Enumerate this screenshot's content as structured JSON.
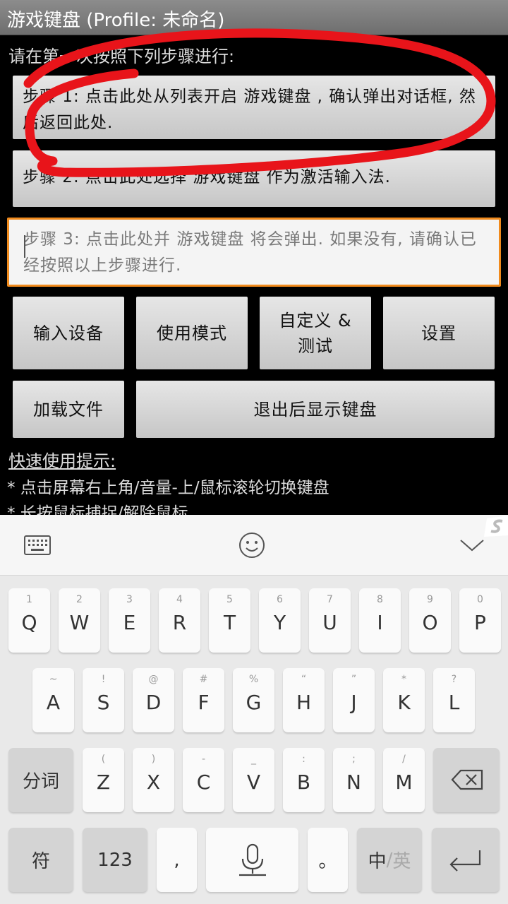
{
  "title": "游戏键盘 (Profile: 未命名)",
  "instruction": "请在第一次按照下列步骤进行:",
  "steps": [
    "步骤 1: 点击此处从列表开启 游戏键盘 , 确认弹出对话框, 然后返回此处.",
    "步骤 2: 点击此处选择 游戏键盘 作为激活输入法.",
    "步骤 3: 点击此处并 游戏键盘 将会弹出. 如果没有, 请确认已经按照以上步骤进行."
  ],
  "buttons": {
    "input_device": "输入设备",
    "use_mode": "使用模式",
    "customize_test_line1": "自定义 &",
    "customize_test_line2": "测试",
    "settings": "设置",
    "load_file": "加载文件",
    "show_keyboard_on_exit": "退出后显示键盘"
  },
  "tips": {
    "heading": "快速使用提示:",
    "items": [
      "* 点击屏幕右上角/音量-上/鼠标滚轮切换键盘",
      "* 长按鼠标捕捉/解除鼠标"
    ]
  },
  "keyboard": {
    "toolbar_icons": [
      "keyboard-icon",
      "emoji-icon",
      "collapse-chevron-icon"
    ],
    "row1": [
      {
        "hint": "1",
        "key": "Q"
      },
      {
        "hint": "2",
        "key": "W"
      },
      {
        "hint": "3",
        "key": "E"
      },
      {
        "hint": "4",
        "key": "R"
      },
      {
        "hint": "5",
        "key": "T"
      },
      {
        "hint": "6",
        "key": "Y"
      },
      {
        "hint": "7",
        "key": "U"
      },
      {
        "hint": "8",
        "key": "I"
      },
      {
        "hint": "9",
        "key": "O"
      },
      {
        "hint": "0",
        "key": "P"
      }
    ],
    "row2": [
      {
        "hint": "~",
        "key": "A"
      },
      {
        "hint": "!",
        "key": "S"
      },
      {
        "hint": "@",
        "key": "D"
      },
      {
        "hint": "#",
        "key": "F"
      },
      {
        "hint": "%",
        "key": "G"
      },
      {
        "hint": "“",
        "key": "H"
      },
      {
        "hint": "”",
        "key": "J"
      },
      {
        "hint": "*",
        "key": "K"
      },
      {
        "hint": "?",
        "key": "L"
      }
    ],
    "row3": [
      {
        "hint": "(",
        "key": "Z"
      },
      {
        "hint": ")",
        "key": "X"
      },
      {
        "hint": "-",
        "key": "C"
      },
      {
        "hint": "_",
        "key": "V"
      },
      {
        "hint": ":",
        "key": "B"
      },
      {
        "hint": ";",
        "key": "N"
      },
      {
        "hint": "/",
        "key": "M"
      }
    ],
    "segment_key": "分词",
    "symbol_key": "符",
    "num_key": "123",
    "comma_key": ",",
    "period_key": "。",
    "lang_cn": "中",
    "lang_sep": "/",
    "lang_en": "英",
    "colors": {
      "background": "#e9e9e9",
      "key": "#fafafa",
      "function_key": "#d4d4d4"
    }
  },
  "colors": {
    "annotation_circle": "#e8141a",
    "step3_border": "#f08a1c",
    "button_gradient_top": "#e6e6e6",
    "button_gradient_bottom": "#c6c6c6"
  }
}
